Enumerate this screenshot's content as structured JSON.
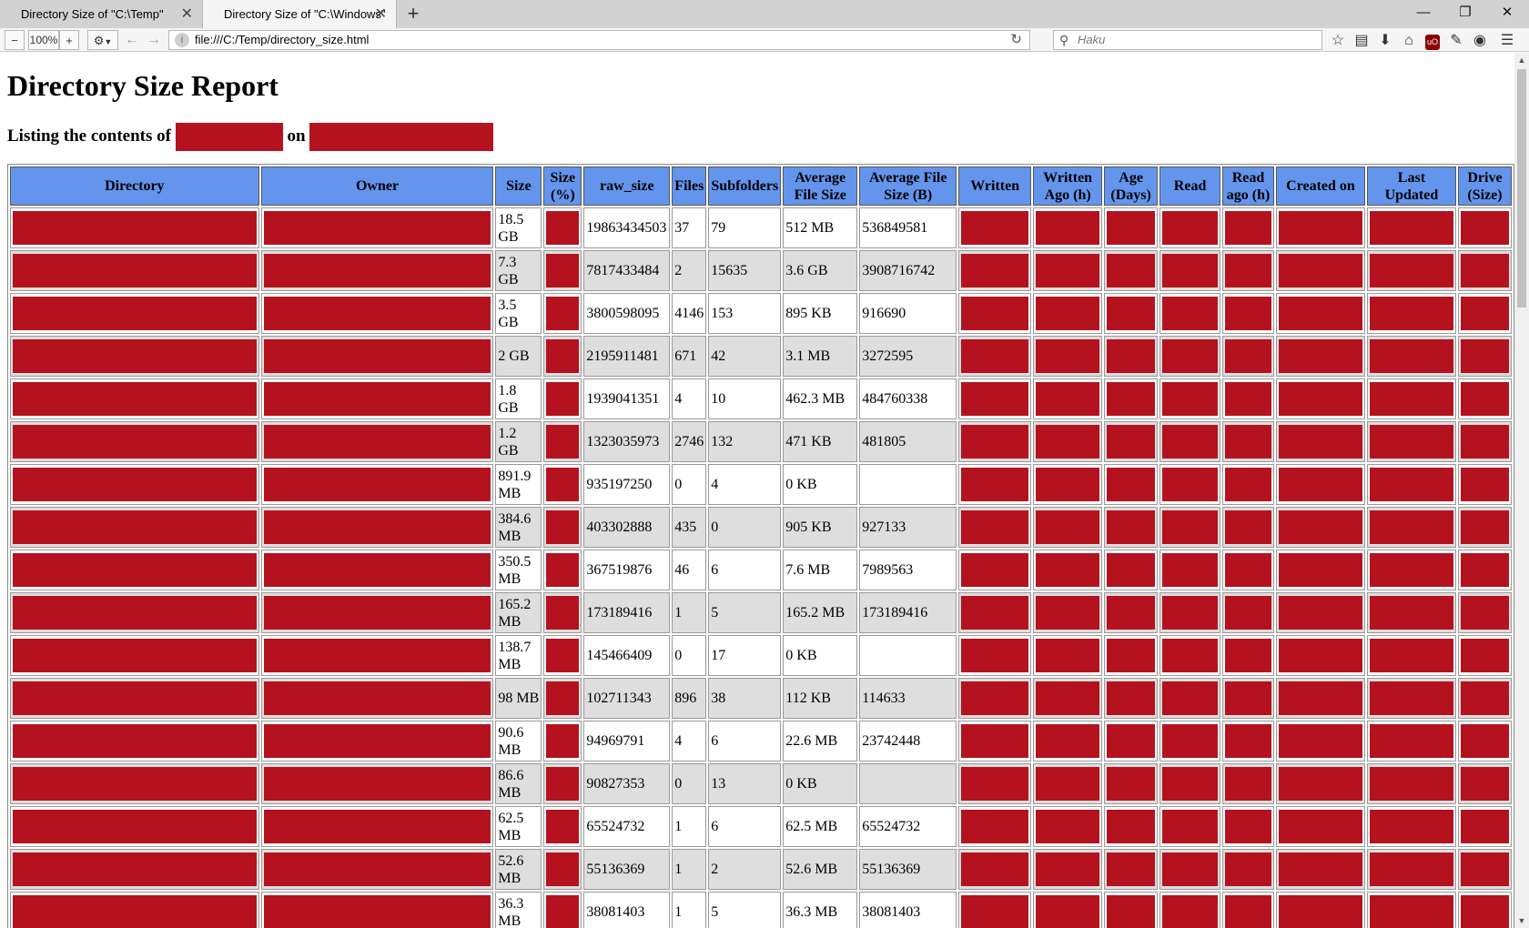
{
  "browser": {
    "tabs": [
      {
        "title": "Directory Size of \"C:\\Temp\""
      },
      {
        "title": "Directory Size of \"C:\\Windows\""
      }
    ],
    "zoom": "100%",
    "url": "file:///C:/Temp/directory_size.html",
    "search_placeholder": "Haku"
  },
  "page": {
    "title": "Directory Size Report",
    "subtitle_prefix": "Listing the contents of",
    "subtitle_mid": "on"
  },
  "table": {
    "headers": [
      "Directory",
      "Owner",
      "Size",
      "Size (%)",
      "raw_size",
      "Files",
      "Subfolders",
      "Average File Size",
      "Average File Size (B)",
      "Written",
      "Written Ago (h)",
      "Age (Days)",
      "Read",
      "Read ago (h)",
      "Created on",
      "Last Updated",
      "Drive (Size)"
    ],
    "rows": [
      {
        "size": "18.5 GB",
        "raw_size": "19863434503",
        "files": "37",
        "subfolders": "79",
        "avg": "512 MB",
        "avg_b": "536849581"
      },
      {
        "size": "7.3 GB",
        "raw_size": "7817433484",
        "files": "2",
        "subfolders": "15635",
        "avg": "3.6 GB",
        "avg_b": "3908716742"
      },
      {
        "size": "3.5 GB",
        "raw_size": "3800598095",
        "files": "4146",
        "subfolders": "153",
        "avg": "895 KB",
        "avg_b": "916690"
      },
      {
        "size": "2 GB",
        "raw_size": "2195911481",
        "files": "671",
        "subfolders": "42",
        "avg": "3.1 MB",
        "avg_b": "3272595"
      },
      {
        "size": "1.8 GB",
        "raw_size": "1939041351",
        "files": "4",
        "subfolders": "10",
        "avg": "462.3 MB",
        "avg_b": "484760338"
      },
      {
        "size": "1.2 GB",
        "raw_size": "1323035973",
        "files": "2746",
        "subfolders": "132",
        "avg": "471 KB",
        "avg_b": "481805"
      },
      {
        "size": "891.9 MB",
        "raw_size": "935197250",
        "files": "0",
        "subfolders": "4",
        "avg": "0 KB",
        "avg_b": ""
      },
      {
        "size": "384.6 MB",
        "raw_size": "403302888",
        "files": "435",
        "subfolders": "0",
        "avg": "905 KB",
        "avg_b": "927133"
      },
      {
        "size": "350.5 MB",
        "raw_size": "367519876",
        "files": "46",
        "subfolders": "6",
        "avg": "7.6 MB",
        "avg_b": "7989563"
      },
      {
        "size": "165.2 MB",
        "raw_size": "173189416",
        "files": "1",
        "subfolders": "5",
        "avg": "165.2 MB",
        "avg_b": "173189416"
      },
      {
        "size": "138.7 MB",
        "raw_size": "145466409",
        "files": "0",
        "subfolders": "17",
        "avg": "0 KB",
        "avg_b": ""
      },
      {
        "size": "98 MB",
        "raw_size": "102711343",
        "files": "896",
        "subfolders": "38",
        "avg": "112 KB",
        "avg_b": "114633"
      },
      {
        "size": "90.6 MB",
        "raw_size": "94969791",
        "files": "4",
        "subfolders": "6",
        "avg": "22.6 MB",
        "avg_b": "23742448"
      },
      {
        "size": "86.6 MB",
        "raw_size": "90827353",
        "files": "0",
        "subfolders": "13",
        "avg": "0 KB",
        "avg_b": ""
      },
      {
        "size": "62.5 MB",
        "raw_size": "65524732",
        "files": "1",
        "subfolders": "6",
        "avg": "62.5 MB",
        "avg_b": "65524732"
      },
      {
        "size": "52.6 MB",
        "raw_size": "55136369",
        "files": "1",
        "subfolders": "2",
        "avg": "52.6 MB",
        "avg_b": "55136369"
      },
      {
        "size": "36.3 MB",
        "raw_size": "38081403",
        "files": "1",
        "subfolders": "5",
        "avg": "36.3 MB",
        "avg_b": "38081403"
      }
    ]
  },
  "colors": {
    "redaction": "#b5121f",
    "header_bg": "#6495ed",
    "alt_row_bg": "#dedede"
  },
  "icons": {
    "zoom_out": "−",
    "zoom_in": "+",
    "back": "←",
    "forward": "→",
    "reload": "↻",
    "bookmark_star": "☆",
    "reading_list": "▤",
    "download": "⬇",
    "home": "⌂",
    "menu": "☰",
    "new_tab": "+",
    "close_tab": "✕",
    "minimize": "—",
    "restore": "❐",
    "close_window": "✕",
    "search": "🔍"
  }
}
